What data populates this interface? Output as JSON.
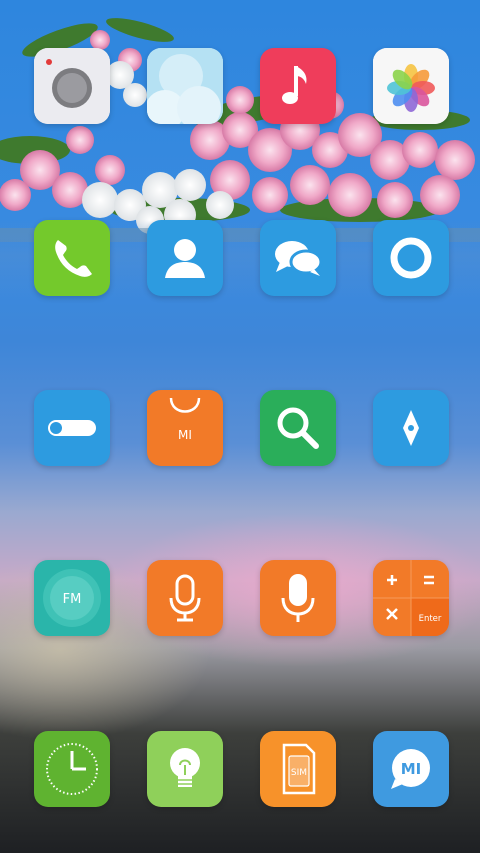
{
  "screen": "home",
  "apps": [
    {
      "id": "camera",
      "icon": "camera-icon",
      "color": "#e9e9ee"
    },
    {
      "id": "weather",
      "icon": "weather-icon",
      "color": "#a8dcf0"
    },
    {
      "id": "music",
      "icon": "music-note-icon",
      "color": "#ef3d5b"
    },
    {
      "id": "gallery",
      "icon": "gallery-flower-icon",
      "color": "#f5f5f5"
    },
    {
      "id": "phone",
      "icon": "phone-icon",
      "color": "#74c92c"
    },
    {
      "id": "contacts",
      "icon": "contact-icon",
      "color": "#2d9be0"
    },
    {
      "id": "messages",
      "icon": "message-bubbles-icon",
      "color": "#2d9be0"
    },
    {
      "id": "browser",
      "icon": "browser-ring-icon",
      "color": "#2d9be0"
    },
    {
      "id": "settings",
      "icon": "toggle-switch-icon",
      "color": "#2d9be0"
    },
    {
      "id": "mi-store",
      "icon": "shopping-bag-icon",
      "color": "#f27a28",
      "label": "MI"
    },
    {
      "id": "search",
      "icon": "search-icon",
      "color": "#2aae5a"
    },
    {
      "id": "compass",
      "icon": "compass-icon",
      "color": "#2d9be0"
    },
    {
      "id": "fm-radio",
      "icon": "fm-radio-icon",
      "color": "#2ab5aa",
      "label": "FM"
    },
    {
      "id": "recorder",
      "icon": "microphone-outline-icon",
      "color": "#f27a28"
    },
    {
      "id": "voice-assistant",
      "icon": "microphone-icon",
      "color": "#f27a28"
    },
    {
      "id": "calculator",
      "icon": "calculator-icon",
      "color": "#f27a28",
      "label": "Enter"
    },
    {
      "id": "clock",
      "icon": "clock-icon",
      "color": "#5fb330"
    },
    {
      "id": "tips",
      "icon": "lightbulb-icon",
      "color": "#8fd05a"
    },
    {
      "id": "sim-toolkit",
      "icon": "sim-card-icon",
      "color": "#f7922a",
      "label": "SIM"
    },
    {
      "id": "mi-community",
      "icon": "mi-chat-icon",
      "color": "#3f9ae0",
      "label": "MI"
    }
  ]
}
